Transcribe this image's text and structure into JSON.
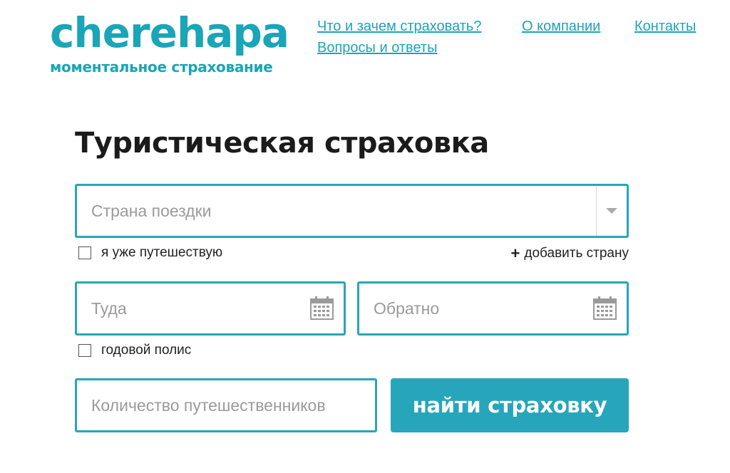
{
  "brand": {
    "logo": "cherehapa",
    "tagline": "моментальное страхование",
    "color": "#1aa5b8"
  },
  "nav": {
    "items": [
      {
        "label": "Что и зачем страховать?"
      },
      {
        "label": "О компании"
      },
      {
        "label": "Контакты"
      },
      {
        "label": "Вопросы и ответы"
      }
    ]
  },
  "page": {
    "title": "Туристическая страховка"
  },
  "form": {
    "country": {
      "placeholder": "Страна поездки",
      "value": ""
    },
    "already_traveling_label": "я уже путешествую",
    "add_country": {
      "icon": "plus-icon",
      "label": "добавить страну"
    },
    "date_to": {
      "placeholder": "Туда",
      "icon": "calendar-icon"
    },
    "date_back": {
      "placeholder": "Обратно",
      "icon": "calendar-icon"
    },
    "annual_policy_label": "годовой полис",
    "travelers": {
      "placeholder": "Количество путешественников"
    },
    "submit_label": "найти страховку",
    "accent_color": "#27a6bb"
  }
}
